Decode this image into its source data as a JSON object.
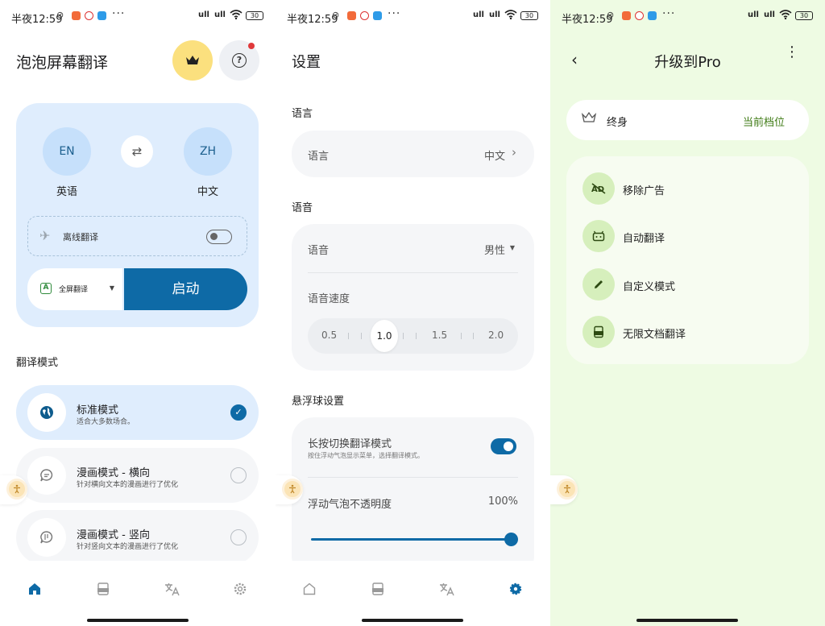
{
  "status_bar": {
    "time": "半夜12:59",
    "signal1": "ull",
    "signal2": "ull",
    "battery": "30"
  },
  "panel1": {
    "title": "泡泡屏幕翻译",
    "source_lang": {
      "code": "EN",
      "name": "英语"
    },
    "target_lang": {
      "code": "ZH",
      "name": "中文"
    },
    "offline_label": "离线翻译",
    "offline_enabled": false,
    "mode_select_label": "全屏翻译",
    "start_button": "启动",
    "section_title": "翻译模式",
    "modes": [
      {
        "title": "标准模式",
        "desc": "适合大多数场合。",
        "selected": true,
        "icon": "globe-icon"
      },
      {
        "title": "漫画模式 - 横向",
        "desc": "针对横向文本的漫画进行了优化",
        "selected": false,
        "icon": "chat-bubble-icon"
      },
      {
        "title": "漫画模式 - 竖向",
        "desc": "针对竖向文本的漫画进行了优化",
        "selected": false,
        "icon": "vertical-text-icon"
      }
    ],
    "nav": [
      "home-icon",
      "document-icon",
      "translate-icon",
      "settings-icon"
    ],
    "active_nav": "home-icon"
  },
  "panel2": {
    "title": "设置",
    "language_section": "语言",
    "language_label": "语言",
    "language_value": "中文",
    "voice_section": "语音",
    "voice_label": "语音",
    "voice_value": "男性",
    "speed_label": "语音速度",
    "speed_ticks": [
      "0.5",
      "1.0",
      "1.5",
      "2.0"
    ],
    "speed_value": 1.0,
    "float_section": "悬浮球设置",
    "longpress_label": "长按切换翻译模式",
    "longpress_desc": "按住浮动气泡显示菜单，选择翻译模式。",
    "longpress_enabled": true,
    "opacity_label": "浮动气泡不透明度",
    "opacity_value": "100%",
    "active_nav": "settings-icon"
  },
  "panel3": {
    "title": "升级到Pro",
    "plan_name": "终身",
    "plan_status": "当前档位",
    "features": [
      {
        "label": "移除广告",
        "icon": "no-ads-icon"
      },
      {
        "label": "自动翻译",
        "icon": "robot-icon"
      },
      {
        "label": "自定义模式",
        "icon": "pencil-icon"
      },
      {
        "label": "无限文档翻译",
        "icon": "pdf-icon"
      }
    ]
  },
  "colors": {
    "accent": "#0e6aa6",
    "card_blue": "#dfedfd",
    "crown_yellow": "#fbe07e",
    "pro_green": "#3e7a14",
    "pro_bg": "#eefbe3"
  }
}
